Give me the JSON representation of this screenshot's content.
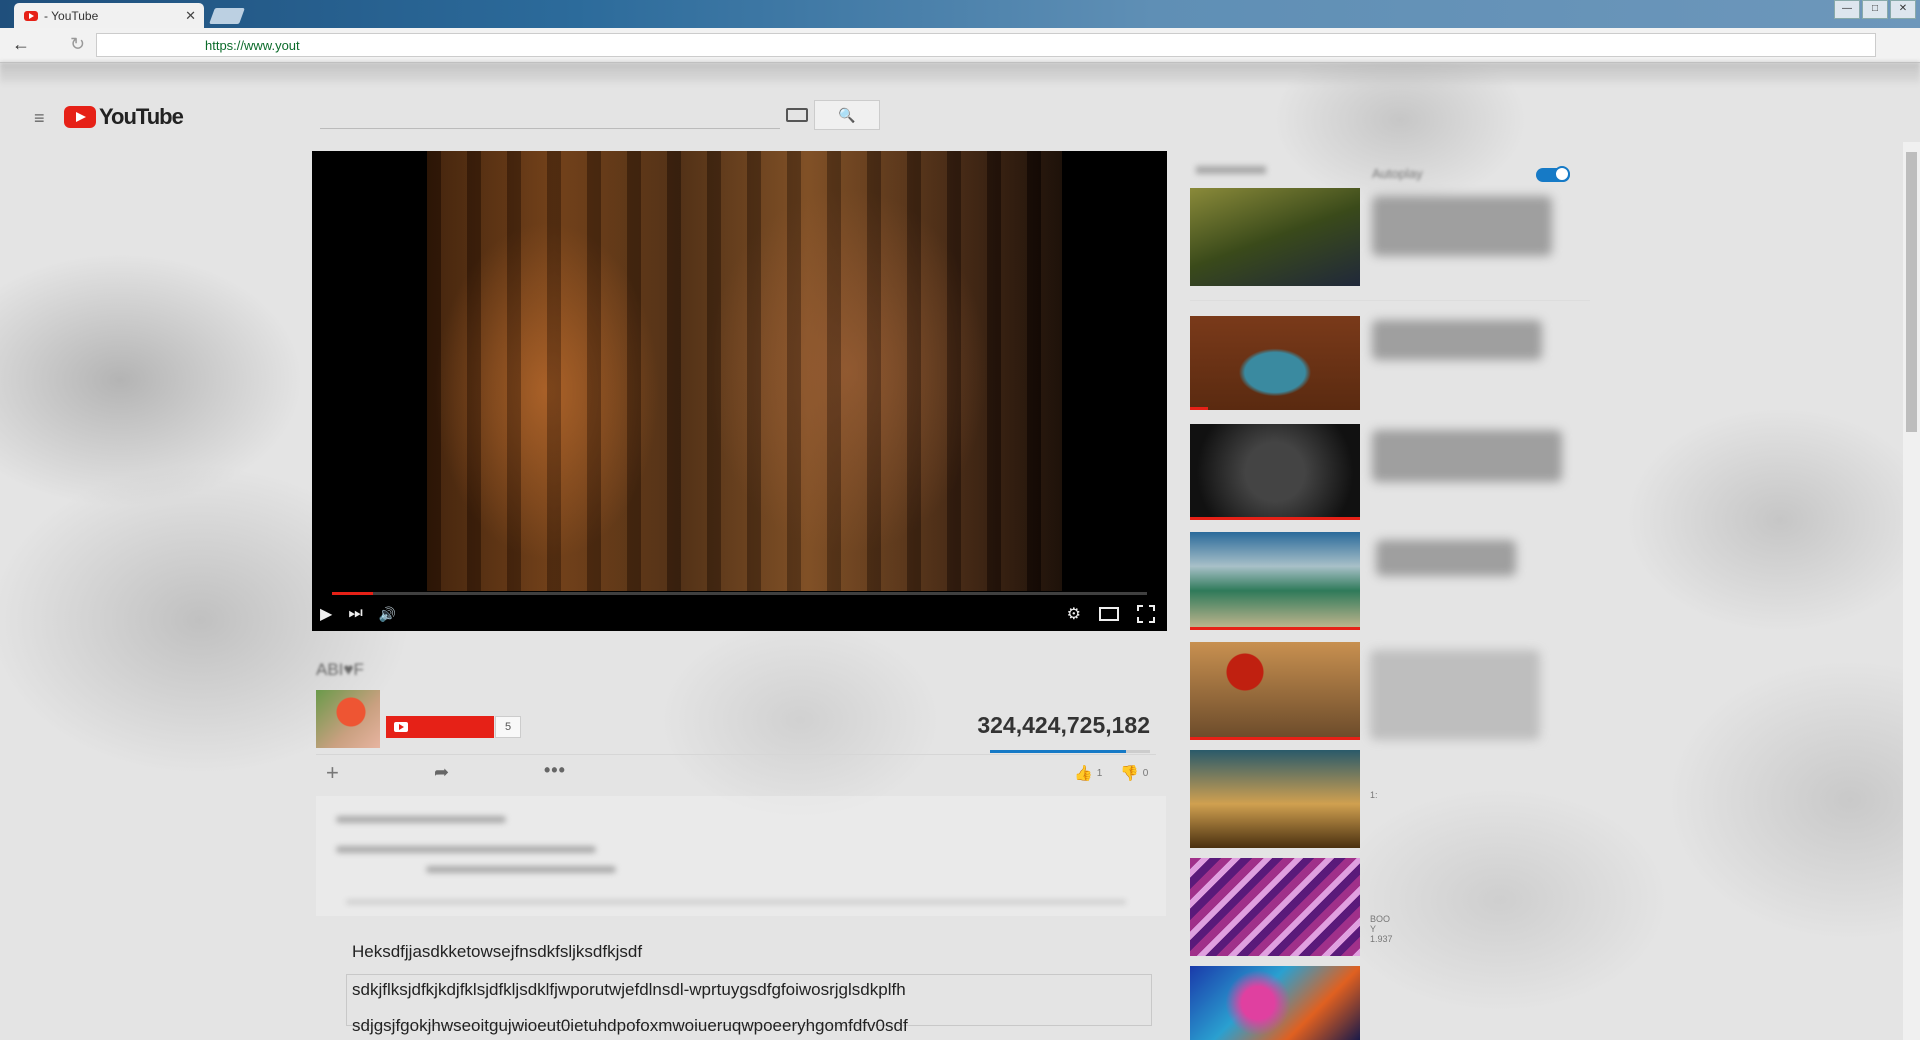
{
  "browser": {
    "tab_title": "- YouTube",
    "tab_close": "✕",
    "url": "https://www.yout",
    "back_icon": "←",
    "reload_icon": "↻"
  },
  "masthead": {
    "logo_text": "YouTube",
    "menu_icon": "≡",
    "search_icon": "🔍"
  },
  "player": {
    "progress_fraction": 0.05,
    "play_icon": "▶",
    "next_icon": "⏭",
    "volume_icon": "🔊",
    "settings_icon": "⚙"
  },
  "video": {
    "title": "ABI♥F",
    "subscribe_count": "5",
    "view_count": "324,424,725,182",
    "like_count": "1",
    "dislike_count": "0",
    "like_fraction": 0.85,
    "add_icon": "+",
    "share_icon": "➦",
    "more_icon": "•••",
    "like_icon": "👍",
    "dislike_icon": "👍"
  },
  "comments": {
    "line1": "Heksdfjjasdkketowsejfnsdkfsljksdfkjsdf",
    "line2": "sdkjflksjdfkjkdjfklsjdfkljsdklfjwporutwjefdlnsdl-wprtuygsdfgfoiwosrjglsdkplfh",
    "line3": "sdjgsjfgokjhwseoitgujwioeut0ietuhdpofoxmwoiueruqwpoeeryhgomfdfv0sdf"
  },
  "sidebar": {
    "autoplay_label": "Autoplay",
    "cards": [
      {
        "meta": ""
      },
      {
        "meta": ""
      },
      {
        "meta": ""
      },
      {
        "meta": ""
      },
      {
        "meta": ""
      },
      {
        "meta": "1:"
      },
      {
        "meta": "BOO Y 1.937"
      },
      {
        "meta": ""
      }
    ]
  },
  "window_controls": [
    "—",
    "□",
    "✕"
  ]
}
